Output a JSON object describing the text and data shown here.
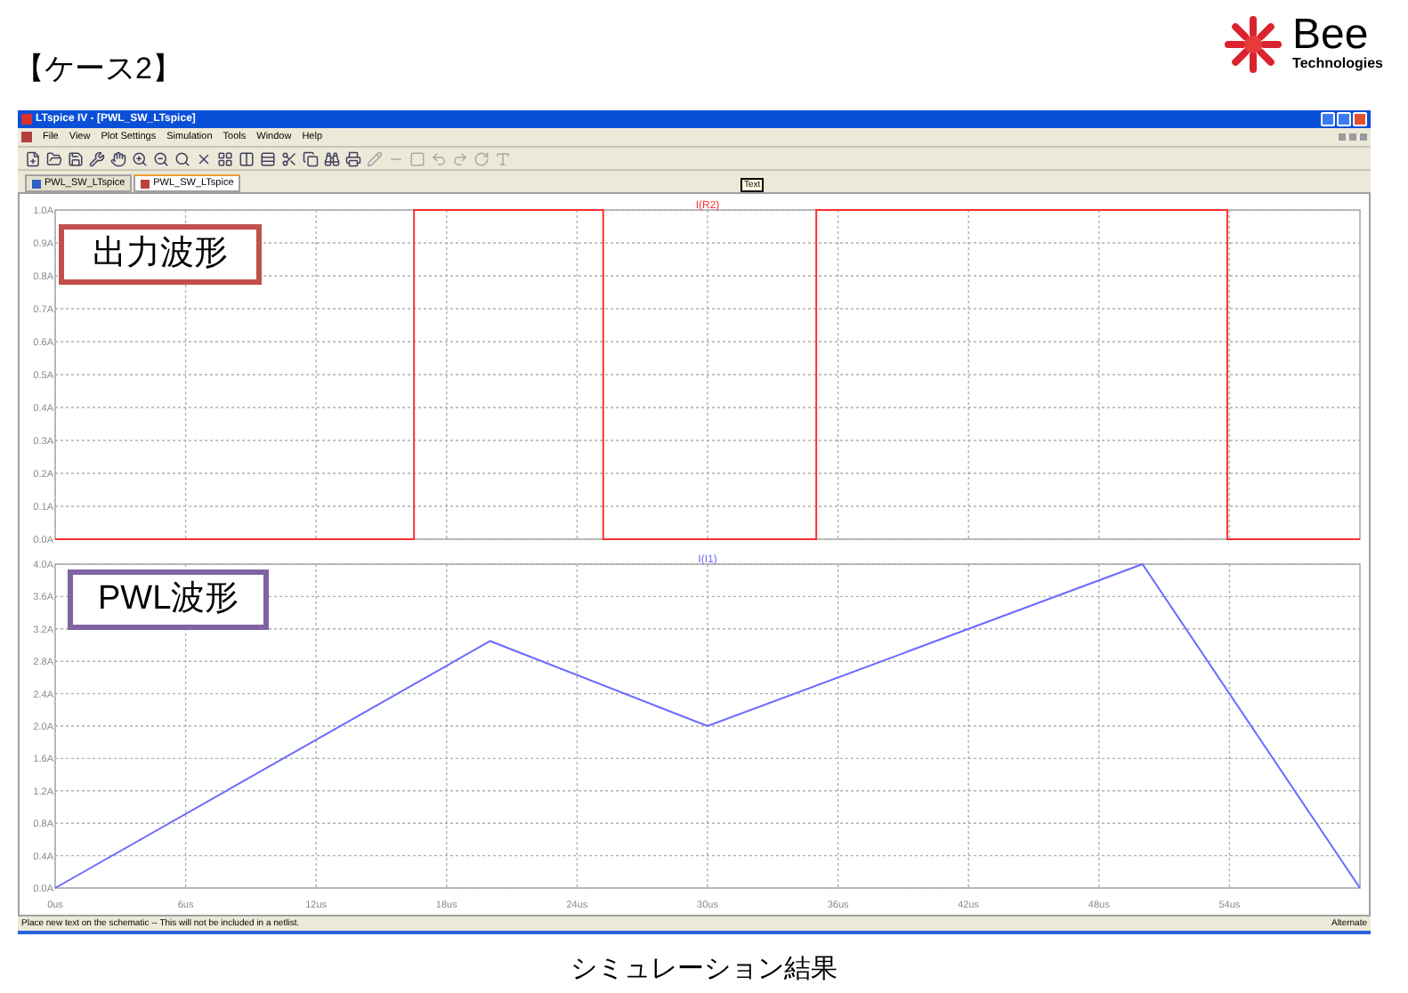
{
  "slide": {
    "title": "【ケース2】",
    "logo": {
      "name": "Bee",
      "subtitle": "Technologies"
    },
    "caption": "シミュレーション結果"
  },
  "window": {
    "title": "LTspice IV - [PWL_SW_LTspice]",
    "menu": [
      "File",
      "View",
      "Plot Settings",
      "Simulation",
      "Tools",
      "Window",
      "Help"
    ],
    "tabs": [
      {
        "label": "PWL_SW_LTspice",
        "kind": "schematic",
        "selected": false
      },
      {
        "label": "PWL_SW_LTspice",
        "kind": "waveform",
        "selected": true
      }
    ],
    "tooltip": "Text",
    "panes": [
      {
        "callout": {
          "text": "出力波形",
          "color": "#c0504d"
        },
        "chart_data": {
          "type": "line",
          "grid": true,
          "xlim": [
            0,
            60
          ],
          "ylim": [
            0,
            1
          ],
          "yticks": [
            {
              "value": 1,
              "label": "1.0A"
            },
            {
              "value": 0.9,
              "label": "0.9A"
            },
            {
              "value": 0.8,
              "label": "0.8A"
            },
            {
              "value": 0.7,
              "label": "0.7A"
            },
            {
              "value": 0.6,
              "label": "0.6A"
            },
            {
              "value": 0.5,
              "label": "0.5A"
            },
            {
              "value": 0.4,
              "label": "0.4A"
            },
            {
              "value": 0.3,
              "label": "0.3A"
            },
            {
              "value": 0.2,
              "label": "0.2A"
            },
            {
              "value": 0.1,
              "label": "0.1A"
            },
            {
              "value": 0,
              "label": "0.0A"
            }
          ],
          "x": [
            0,
            16.5,
            16.5,
            25.2,
            25.2,
            35,
            35,
            53.9,
            53.9,
            60
          ],
          "series": [
            {
              "name": "I(R2)",
              "color": "#ff3030",
              "values": [
                0,
                0,
                1,
                1,
                0,
                0,
                1,
                1,
                0,
                0
              ]
            }
          ]
        }
      },
      {
        "callout": {
          "text": "PWL波形",
          "color": "#8064a2"
        },
        "chart_data": {
          "type": "line",
          "grid": true,
          "xlim": [
            0,
            60
          ],
          "ylim": [
            0,
            4
          ],
          "xticks": [
            {
              "value": 0,
              "label": "0us"
            },
            {
              "value": 6,
              "label": "6us"
            },
            {
              "value": 12,
              "label": "12us"
            },
            {
              "value": 18,
              "label": "18us"
            },
            {
              "value": 24,
              "label": "24us"
            },
            {
              "value": 30,
              "label": "30us"
            },
            {
              "value": 36,
              "label": "36us"
            },
            {
              "value": 42,
              "label": "42us"
            },
            {
              "value": 48,
              "label": "48us"
            },
            {
              "value": 54,
              "label": "54us"
            }
          ],
          "yticks": [
            {
              "value": 4,
              "label": "4.0A"
            },
            {
              "value": 3.6,
              "label": "3.6A"
            },
            {
              "value": 3.2,
              "label": "3.2A"
            },
            {
              "value": 2.8,
              "label": "2.8A"
            },
            {
              "value": 2.4,
              "label": "2.4A"
            },
            {
              "value": 2,
              "label": "2.0A"
            },
            {
              "value": 1.6,
              "label": "1.6A"
            },
            {
              "value": 1.2,
              "label": "1.2A"
            },
            {
              "value": 0.8,
              "label": "0.8A"
            },
            {
              "value": 0.4,
              "label": "0.4A"
            },
            {
              "value": 0,
              "label": "0.0A"
            }
          ],
          "x": [
            0,
            20,
            30,
            50,
            60
          ],
          "series": [
            {
              "name": "I(I1)",
              "color": "#6a6aff",
              "values": [
                0,
                3.05,
                2.0,
                4.0,
                0
              ]
            }
          ]
        }
      }
    ],
    "status_bar": {
      "message": "Place new text on the schematic -- This will not be included in a netlist.",
      "mode": "Alternate"
    }
  }
}
